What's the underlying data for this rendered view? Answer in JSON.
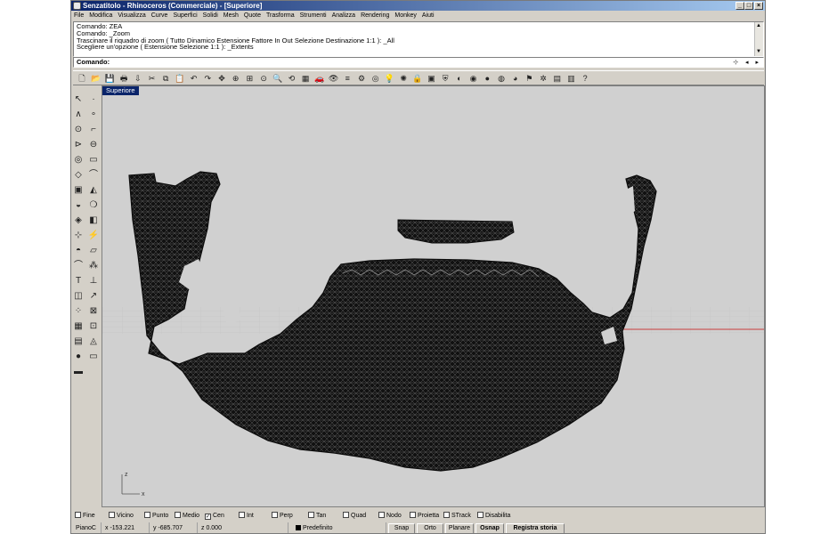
{
  "window": {
    "title": "Senzatitolo - Rhinoceros (Commerciale) - [Superiore]"
  },
  "menubar": [
    "File",
    "Modifica",
    "Visualizza",
    "Curve",
    "Superfici",
    "Solidi",
    "Mesh",
    "Quote",
    "Trasforma",
    "Strumenti",
    "Analizza",
    "Rendering",
    "Monkey",
    "Aiuti"
  ],
  "command_history": [
    "Comando: ZEA",
    "Comando: _Zoom",
    "Trascinare il riquadro di zoom ( Tutto  Dinamico  Estensione  Fattore  In  Out  Selezione  Destinazione  1:1 ): _All",
    "Scegliere un'opzione ( Estensione  Selezione  1:1 ): _Extents"
  ],
  "command_prompt": "Comando:",
  "viewport": {
    "name": "Superiore",
    "background": "#d0d0d0",
    "mesh_color": "#111111",
    "x_axis_color": "#c83c3c",
    "axis_labels": {
      "z": "z",
      "x": "x"
    }
  },
  "toolbar_icons": [
    "new-file-icon",
    "open-icon",
    "save-icon",
    "print-icon",
    "import-icon",
    "cut-icon",
    "copy-icon",
    "paste-icon",
    "undo-icon",
    "redo-icon",
    "pan-icon",
    "zoom-window-icon",
    "zoom-extents-icon",
    "zoom-selected-icon",
    "zoom-icon",
    "rotate-view-icon",
    "four-viewports-icon",
    "car-icon",
    "eye-icon",
    "layers-icon",
    "properties-icon",
    "target-icon",
    "light-bulb-icon",
    "bulb-icon",
    "lock-icon",
    "box-icon",
    "shield-icon",
    "color-wheel-icon",
    "globe-icon",
    "sphere-icon",
    "sphere-dark-icon",
    "sphere-blue-icon",
    "flag-icon",
    "gear-icon",
    "folder-icon",
    "calc-icon",
    "help-icon"
  ],
  "left_tools": [
    "select-arrow-icon",
    "point-icon",
    "polyline-icon",
    "point-cloud-icon",
    "circle-icon",
    "rectangle-icon",
    "arc-icon",
    "ellipse-icon",
    "circle-center-icon",
    "rectangle-round-icon",
    "surface-icon",
    "curve-icon",
    "box-icon",
    "sweep-icon",
    "cylinder-icon",
    "sphere-group-icon",
    "boolean-icon",
    "extrude-icon",
    "array-icon",
    "lightning-icon",
    "sphere-mesh-icon",
    "plane-icon",
    "fillet-icon",
    "scatter-icon",
    "text-icon",
    "dimension-icon",
    "transform-icon",
    "snap-icon",
    "group-icon",
    "block-icon",
    "cube-icon",
    "wireframe-icon",
    "layer-icon",
    "gumball-icon",
    "ball-icon",
    "plane-tool-icon",
    "ruler-icon"
  ],
  "osnap": [
    {
      "label": "Fine",
      "checked": false
    },
    {
      "label": "Vicino",
      "checked": false
    },
    {
      "label": "Punto",
      "checked": false
    },
    {
      "label": "Medio",
      "checked": false
    },
    {
      "label": "Cen",
      "checked": true
    },
    {
      "label": "Int",
      "checked": false
    },
    {
      "label": "Perp",
      "checked": false
    },
    {
      "label": "Tan",
      "checked": false
    },
    {
      "label": "Quad",
      "checked": false
    },
    {
      "label": "Nodo",
      "checked": false
    },
    {
      "label": "Proietta",
      "checked": false
    },
    {
      "label": "STrack",
      "checked": false
    },
    {
      "label": "Disabilita",
      "checked": false
    }
  ],
  "status": {
    "plane": "PianoC",
    "x": "x -153.221",
    "y": "y -685.707",
    "z": "z 0.000",
    "layer": "Predefinito",
    "panes": [
      "Snap",
      "Orto",
      "Planare",
      "Osnap",
      "Registra storia"
    ]
  },
  "colors": {
    "titlebar_start": "#0a246a",
    "titlebar_end": "#a6caf0",
    "chrome": "#d4d0c8"
  }
}
